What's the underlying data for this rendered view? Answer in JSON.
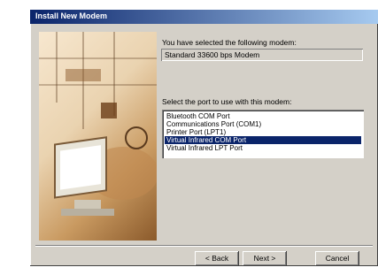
{
  "window": {
    "title": "Install New Modem"
  },
  "modem": {
    "prompt": "You have selected the following modem:",
    "value": "Standard 33600 bps Modem"
  },
  "port": {
    "prompt": "Select the port to use with this modem:",
    "items": [
      {
        "label": "Bluetooth COM Port",
        "selected": false
      },
      {
        "label": "Communications Port (COM1)",
        "selected": false
      },
      {
        "label": "Printer Port (LPT1)",
        "selected": false
      },
      {
        "label": "Virtual Infrared COM Port",
        "selected": true
      },
      {
        "label": "Virtual Infrared LPT Port",
        "selected": false
      }
    ]
  },
  "buttons": {
    "back": "< Back",
    "next": "Next >",
    "cancel": "Cancel"
  },
  "colors": {
    "titlebar_start": "#0a246a",
    "titlebar_end": "#a6caf0",
    "dialog_face": "#d4d0c8",
    "selection": "#0a246a"
  }
}
